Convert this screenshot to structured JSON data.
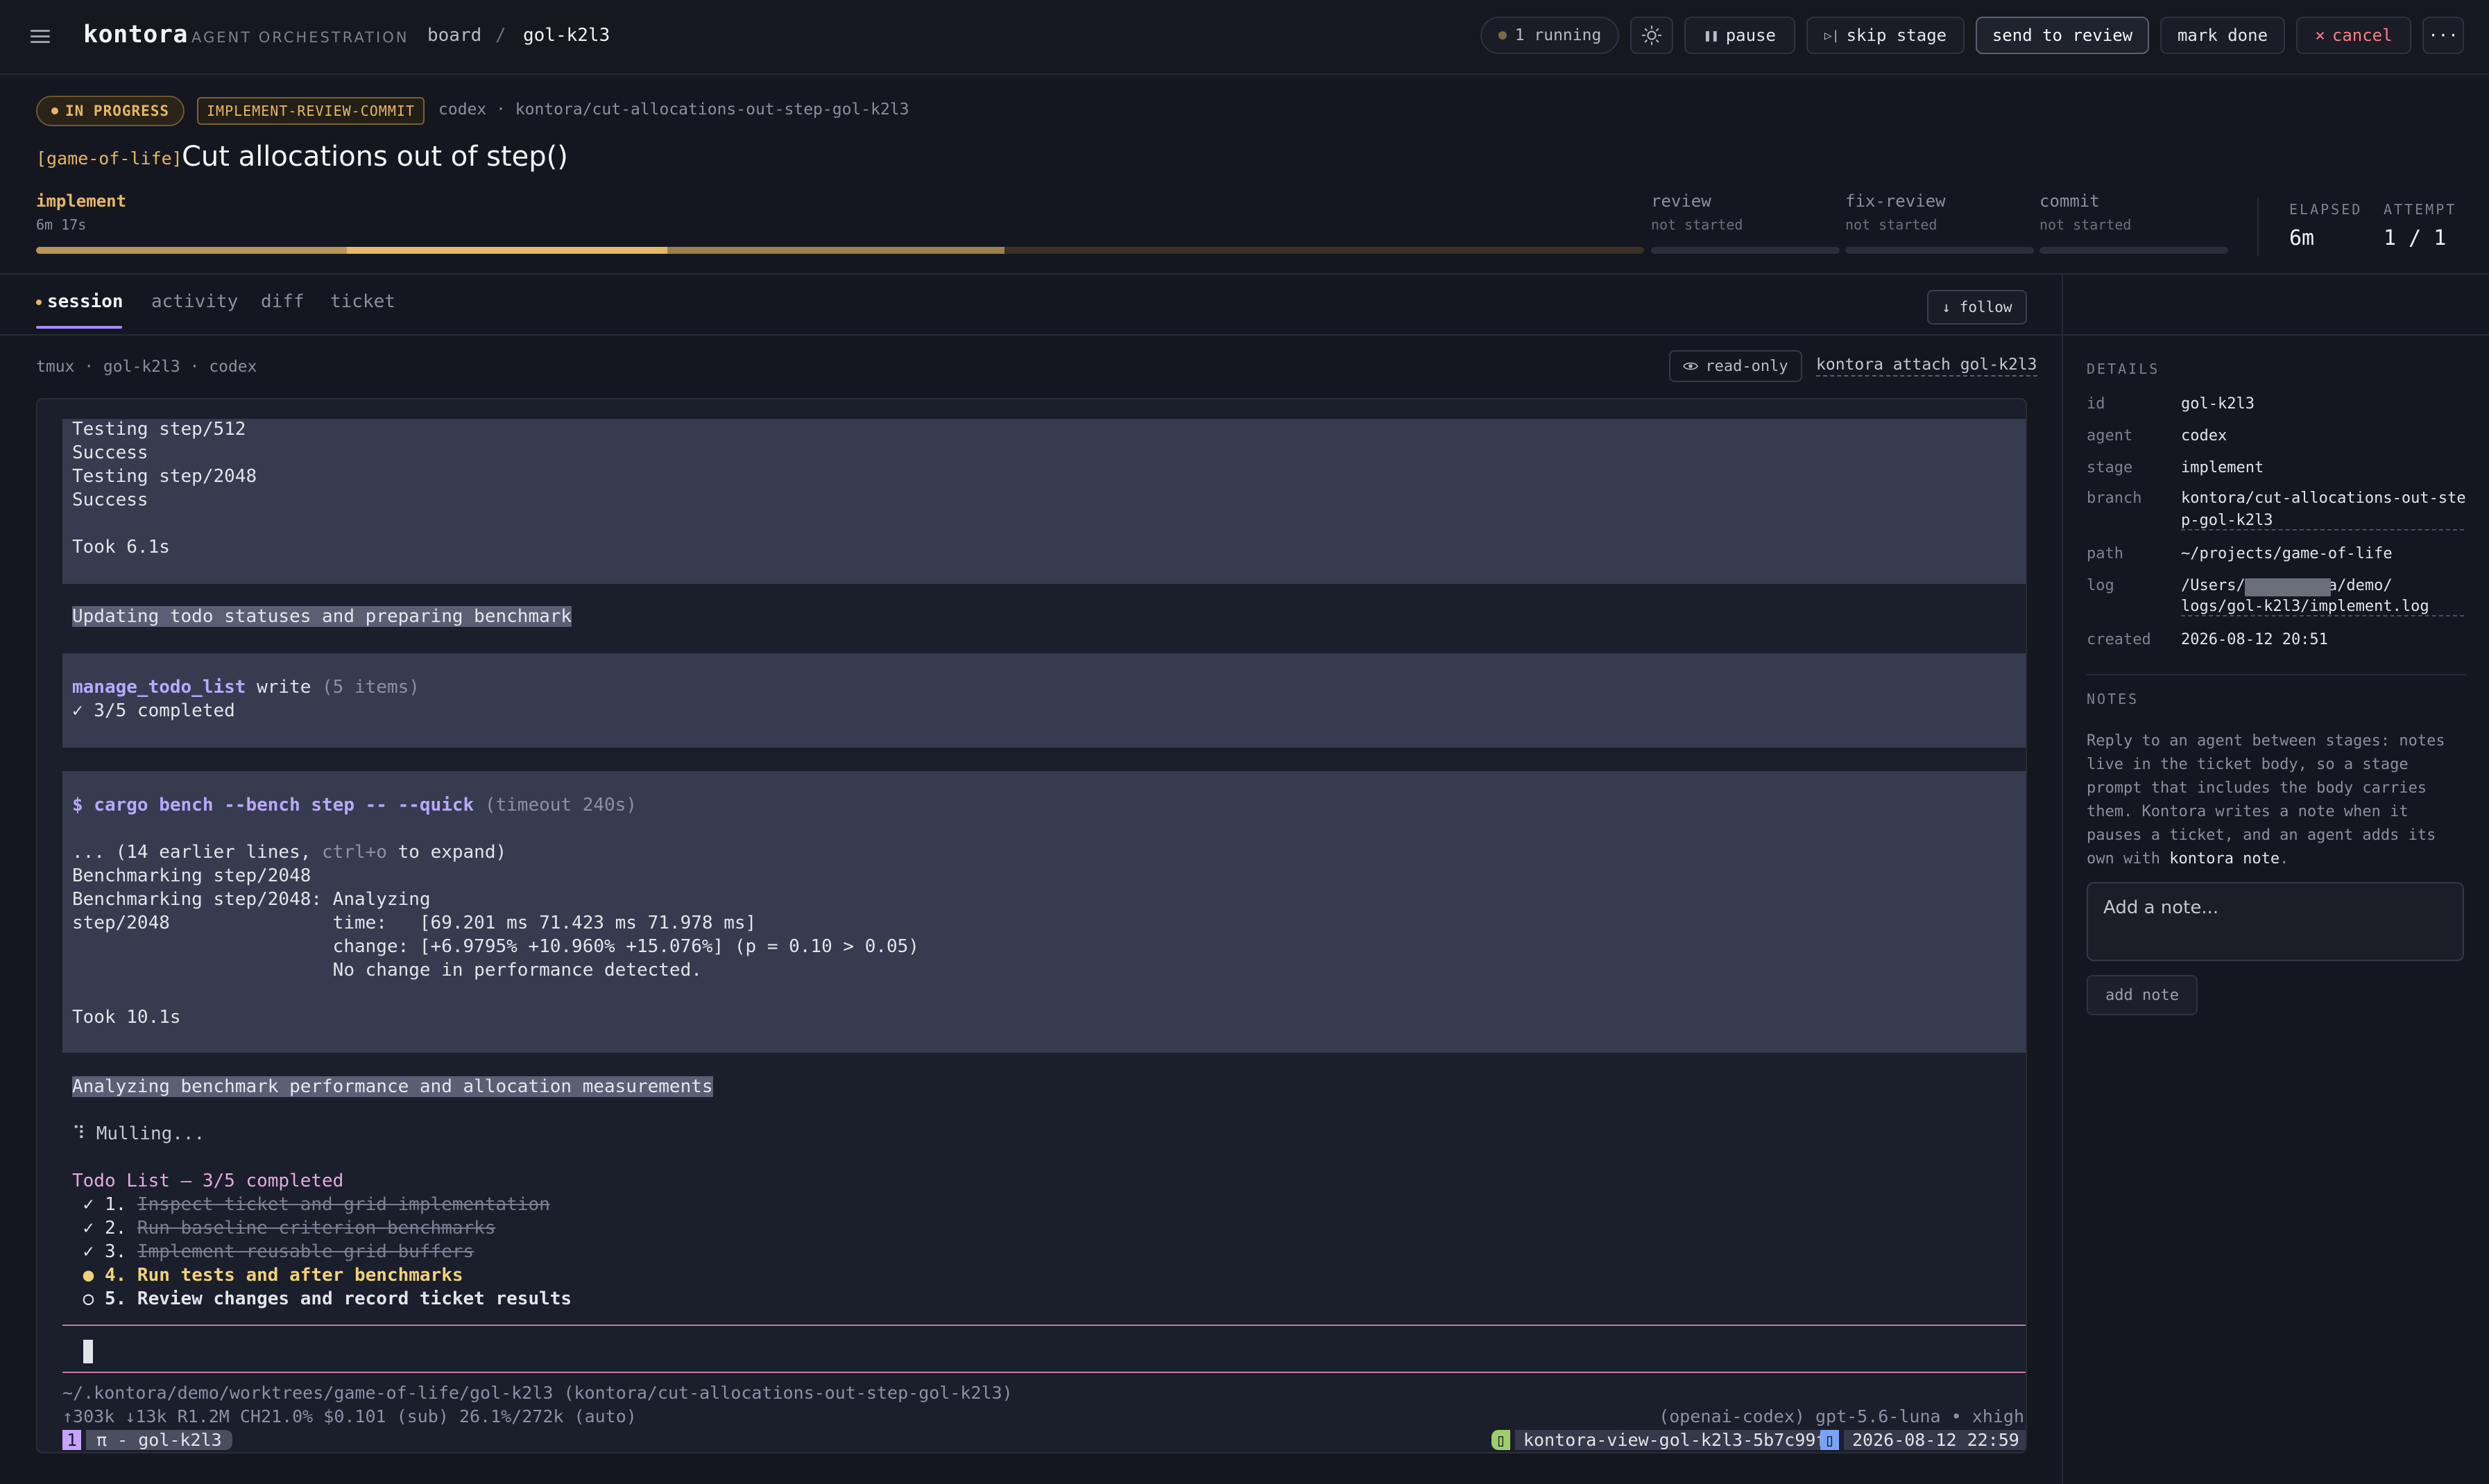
{
  "topbar": {
    "logo": "kontora",
    "tagline": "AGENT ORCHESTRATION",
    "breadcrumb": [
      "board",
      "/",
      "gol-k2l3"
    ],
    "running": "1 running",
    "buttons": {
      "pause": "pause",
      "skip": "skip stage",
      "review": "send to review",
      "done": "mark done",
      "cancel": "cancel",
      "more": "···"
    }
  },
  "ticket": {
    "status": "IN PROGRESS",
    "pipeline": "IMPLEMENT-REVIEW-COMMIT",
    "meta": "codex · kontora/cut-allocations-out-step-gol-k2l3",
    "tag": "[game-of-life]",
    "title": "Cut allocations out of step()"
  },
  "stages": [
    {
      "name": "implement",
      "sub": "6m 17s"
    },
    {
      "name": "review",
      "sub": "not started"
    },
    {
      "name": "fix-review",
      "sub": "not started"
    },
    {
      "name": "commit",
      "sub": "not started"
    }
  ],
  "stats": {
    "elapsed_label": "ELAPSED",
    "elapsed": "6m",
    "attempt_label": "ATTEMPT",
    "attempt": "1 / 1"
  },
  "tabs": [
    "session",
    "activity",
    "diff",
    "ticket"
  ],
  "follow": "↓ follow",
  "session": {
    "label": "tmux · gol-k2l3 · codex",
    "readonly": "read-only",
    "attach": "kontora attach gol-k2l3"
  },
  "terminal": {
    "block1": [
      "Testing step/512",
      "Success",
      "Testing step/2048",
      "Success",
      "",
      "Took 6.1s"
    ],
    "status1": "Updating todo statuses and preparing benchmark",
    "todo_tool": "manage_todo_list",
    "todo_write": " write ",
    "todo_count": "(5 items)",
    "todo_done": "✓ 3/5 completed",
    "cmd": "$ cargo bench --bench step -- --quick",
    "cmd_timeout": " (timeout 240s)",
    "earlier_a": "... (14 earlier lines, ",
    "earlier_key": "ctrl+o",
    "earlier_b": " to expand)",
    "bench": [
      "Benchmarking step/2048",
      "Benchmarking step/2048: Analyzing",
      "step/2048               time:   [69.201 ms 71.423 ms 71.978 ms]",
      "                        change: [+6.9795% +10.960% +15.076%] (p = 0.10 > 0.05)",
      "                        No change in performance detected."
    ],
    "took2": "Took 10.1s",
    "status2": "Analyzing benchmark performance and allocation measurements",
    "mulling": "⠹ Mulling...",
    "todo_title": "Todo List — 3/5 completed",
    "todos": [
      {
        "mark": " ✓ 1. ",
        "text": "Inspect ticket and grid implementation"
      },
      {
        "mark": " ✓ 2. ",
        "text": "Run baseline criterion benchmarks"
      },
      {
        "mark": " ✓ 3. ",
        "text": "Implement reusable grid buffers"
      },
      {
        "mark": " ● 4. ",
        "text": "Run tests and after benchmarks"
      },
      {
        "mark": " ○ 5. ",
        "text": "Review changes and record ticket results"
      }
    ],
    "cwd": "~/.kontora/demo/worktrees/game-of-life/gol-k2l3 (kontora/cut-allocations-out-step-gol-k2l3)",
    "usage": "↑303k ↓13k R1.2M CH21.0% $0.101 (sub) 26.1%/272k (auto)",
    "model": "(openai-codex) gpt-5.6-luna • xhigh",
    "win_index": "1",
    "win_name": " π - gol-k2l3 ",
    "session_name": "kontora-view-gol-k2l3-5b7c99f",
    "clock": "2026-08-12 22:59"
  },
  "details": {
    "heading": "DETAILS",
    "rows": [
      {
        "k": "id",
        "v": "gol-k2l3"
      },
      {
        "k": "agent",
        "v": "codex"
      },
      {
        "k": "stage",
        "v": "implement"
      },
      {
        "k": "branch",
        "v": "kontora/cut-allocations-out-ste",
        "v2": "p-gol-k2l3"
      },
      {
        "k": "path",
        "v": "~/projects/game-of-life"
      },
      {
        "k": "log",
        "v": "/Users/          /.kontora/demo/",
        "v2": "logs/gol-k2l3/implement.log"
      },
      {
        "k": "created",
        "v": "2026-08-12 20:51"
      }
    ]
  },
  "notes": {
    "heading": "NOTES",
    "text": "Reply to an agent between stages: notes live in the ticket body, so a stage prompt that includes the body carries them. Kontora writes a note when it pauses a ticket, and an agent adds its own with ",
    "cmd": "kontora note",
    "end": ".",
    "placeholder": "Add a note...",
    "add": "add note"
  },
  "colors": {
    "accent": "#e6b766",
    "tab_underline": "#a78bfa",
    "danger": "#ff7b86"
  }
}
